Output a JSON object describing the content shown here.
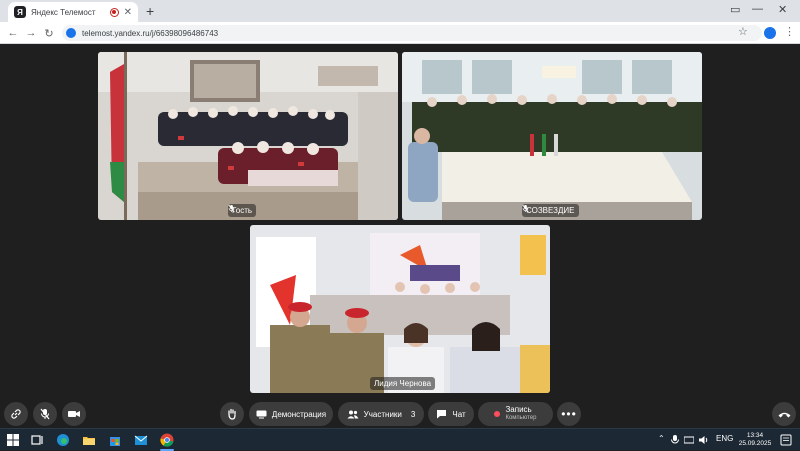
{
  "browser": {
    "tab_title": "Яндекс Телемост",
    "tab_favicon": "Я",
    "url": "telemost.yandex.ru/j/66398096486743",
    "icons": [
      "back-arrow-icon",
      "forward-arrow-icon",
      "reload-icon",
      "star-icon",
      "profile-icon",
      "more-icon"
    ]
  },
  "participants": [
    {
      "name": "Гость",
      "mic_muted": true
    },
    {
      "name": "СОЗВЕЗДИЕ",
      "mic_muted": true
    },
    {
      "name": "Лидия Чернова",
      "mic_muted": false
    }
  ],
  "controls": {
    "demo_label": "Демонстрация",
    "participants_label": "Участники",
    "participants_count": "3",
    "chat_label": "Чат",
    "record_label": "Запись",
    "record_sub": "Компьютер"
  },
  "taskbar": {
    "lang": "ENG",
    "time": "13:34",
    "date": "25.09.2025"
  },
  "colors": {
    "stage_bg": "#1f1f1f",
    "button_bg": "#3c3c3c",
    "record_red": "#ff4d5a",
    "taskbar_bg": "#1c2833"
  }
}
